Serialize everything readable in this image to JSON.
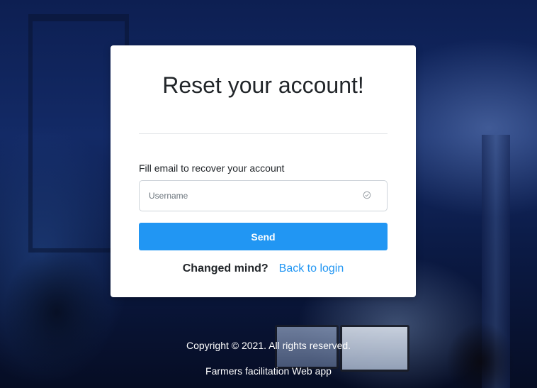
{
  "card": {
    "title": "Reset your account!",
    "field_label": "Fill email to recover your account",
    "username_placeholder": "Username",
    "username_value": "",
    "send_label": "Send",
    "prompt_text": "Changed mind?",
    "back_link_label": "Back to login"
  },
  "footer": {
    "copyright": "Copyright © 2021. All rights reserved.",
    "app_name": "Farmers facilitation Web app"
  },
  "icons": {
    "input_status": "check-circle-icon"
  },
  "colors": {
    "accent": "#2196f3",
    "card_background": "#ffffff",
    "title_text": "#212529",
    "page_background": "#0d1f52"
  }
}
